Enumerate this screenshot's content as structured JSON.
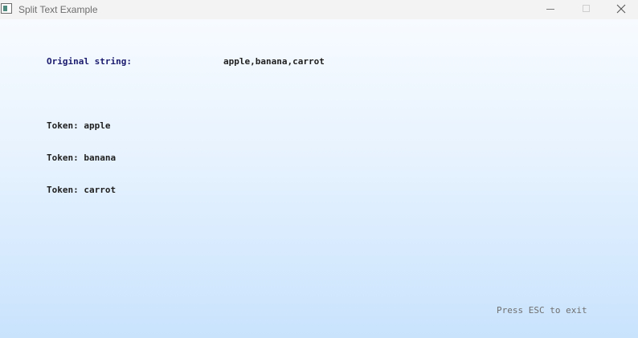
{
  "window": {
    "title": "Split Text Example",
    "icons": {
      "app": "app-window-icon",
      "minimize": "minimize-icon",
      "maximize": "maximize-icon",
      "close": "close-icon"
    }
  },
  "content": {
    "original_label": "Original string:",
    "original_value": "apple,banana,carrot",
    "tokens": [
      "Token: apple",
      "Token: banana",
      "Token: carrot"
    ],
    "exit_hint": "Press ESC to exit"
  },
  "colors": {
    "background_top": "#f7fbff",
    "background_bottom": "#c9e3fd",
    "label_color": "#1a1a6e",
    "text_color": "#1e1e1e",
    "hint_color": "#6f6f6f"
  }
}
